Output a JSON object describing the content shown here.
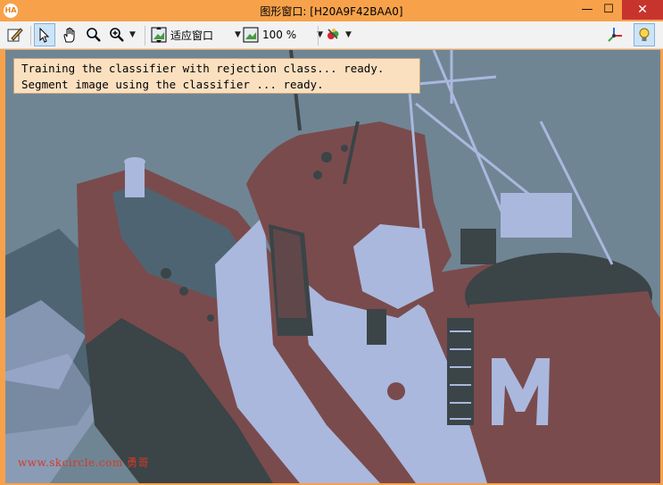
{
  "window": {
    "title": "图形窗口: [H20A9F42BAA0]",
    "app_icon_text": "HA",
    "controls": {
      "minimize": "—",
      "maximize": "☐",
      "close": "✕"
    }
  },
  "toolbar": {
    "fit_window_label": "适应窗口",
    "zoom_label": "100 %"
  },
  "console": {
    "lines": [
      "Training the classifier with rejection class... ready.",
      "Segment image using the classifier ... ready."
    ]
  },
  "watermark": "www.skcircle.com 勇哥",
  "colors": {
    "title_bar": "#f7a24b",
    "close_button": "#c7342e",
    "class_slate": "#4f6472",
    "class_maroon": "#7a4b4c",
    "class_lightblue": "#aab8de",
    "class_darkgray": "#3b4447",
    "console_bg": "#fbe0c0"
  }
}
